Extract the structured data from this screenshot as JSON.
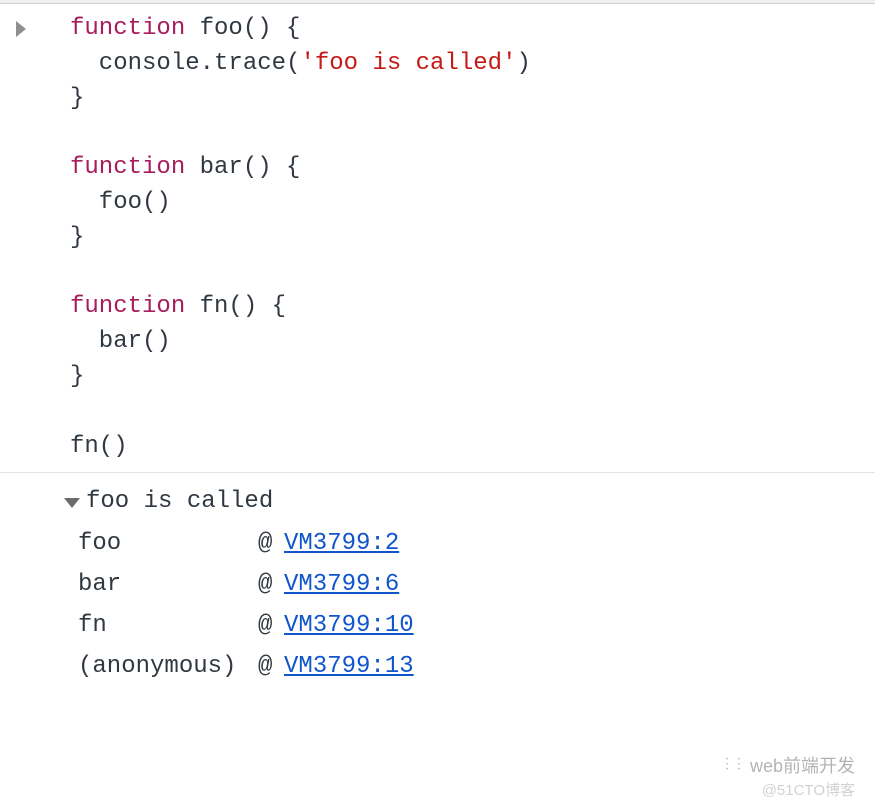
{
  "code": {
    "line1_kw": "function",
    "line1_rest": " foo() {",
    "line2_pre": "  console.trace(",
    "line2_str": "'foo is called'",
    "line2_post": ")",
    "line3": "}",
    "blank1": "",
    "line4_kw": "function",
    "line4_rest": " bar() {",
    "line5": "  foo()",
    "line6": "}",
    "blank2": "",
    "line7_kw": "function",
    "line7_rest": " fn() {",
    "line8": "  bar()",
    "line9": "}",
    "blank3": "",
    "line10": "fn()"
  },
  "trace": {
    "header": "foo is called",
    "at": "@",
    "rows": [
      {
        "fn": "foo",
        "loc": "VM3799:2"
      },
      {
        "fn": "bar",
        "loc": "VM3799:6"
      },
      {
        "fn": "fn",
        "loc": "VM3799:10"
      },
      {
        "fn": "(anonymous)",
        "loc": "VM3799:13"
      }
    ]
  },
  "watermark": {
    "main": "web前端开发",
    "sub": "@51CTO博客"
  }
}
